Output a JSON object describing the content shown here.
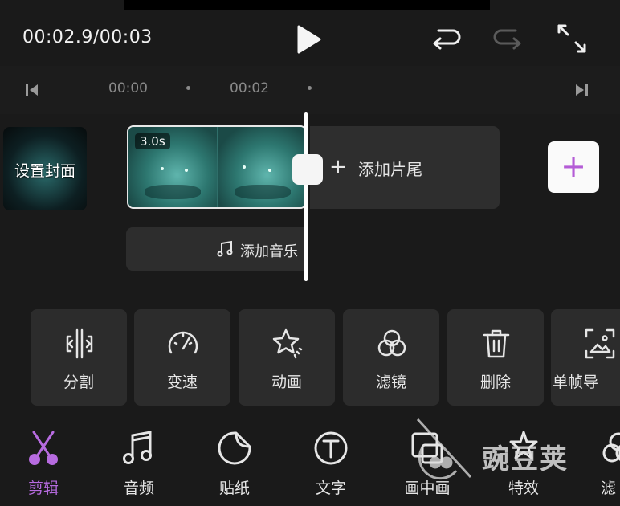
{
  "player": {
    "time_readout": "00:02.9/00:03"
  },
  "ruler": {
    "ticks": [
      "00:00",
      "00:02"
    ]
  },
  "timeline": {
    "cover_label": "设置封面",
    "clip_duration": "3.0s",
    "add_ending_label": "添加片尾",
    "add_music_label": "添加音乐"
  },
  "tools": [
    {
      "label": "分割",
      "icon": "split-icon"
    },
    {
      "label": "变速",
      "icon": "speedometer-icon"
    },
    {
      "label": "动画",
      "icon": "star-animation-icon"
    },
    {
      "label": "滤镜",
      "icon": "filter-circles-icon"
    },
    {
      "label": "删除",
      "icon": "trash-icon"
    },
    {
      "label": "单帧导",
      "icon": "frame-export-icon"
    }
  ],
  "bottom_nav": [
    {
      "label": "剪辑",
      "icon": "scissors-icon",
      "active": true
    },
    {
      "label": "音频",
      "icon": "music-note-icon"
    },
    {
      "label": "贴纸",
      "icon": "sticker-icon"
    },
    {
      "label": "文字",
      "icon": "text-icon"
    },
    {
      "label": "画中画",
      "icon": "picture-in-picture-icon"
    },
    {
      "label": "特效",
      "icon": "effects-icon"
    },
    {
      "label": "滤",
      "icon": "filter-icon"
    }
  ],
  "colors": {
    "accent": "#b76be0",
    "background": "#1a1a1a",
    "panel": "#2c2c2c"
  },
  "watermark": {
    "text": "豌豆荚"
  }
}
